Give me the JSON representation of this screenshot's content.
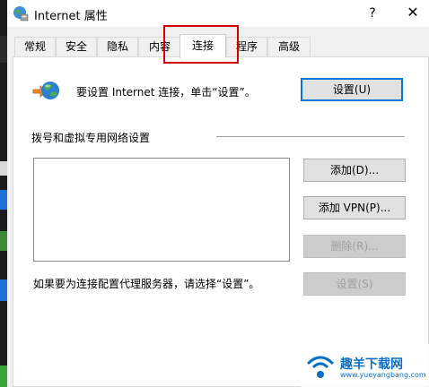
{
  "window": {
    "title": "Internet 属性",
    "help": "?",
    "close": "✕"
  },
  "tabs": [
    {
      "label": "常规"
    },
    {
      "label": "安全"
    },
    {
      "label": "隐私"
    },
    {
      "label": "内容"
    },
    {
      "label": "连接",
      "active": true
    },
    {
      "label": "程序"
    },
    {
      "label": "高级"
    }
  ],
  "connections": {
    "setup_text": "要设置 Internet 连接，单击“设置”。",
    "setup_button": "设置(U)",
    "dialup_section": "拨号和虚拟专用网络设置",
    "add_button": "添加(D)...",
    "add_vpn_button": "添加 VPN(P)...",
    "remove_button": "删除(R)...",
    "proxy_text": "如果要为连接配置代理服务器，请选择“设置”。",
    "settings_button": "设置(S)"
  },
  "watermark": {
    "main": "趣羊下载网",
    "sub": "www.yueyangbang.com"
  },
  "colors": {
    "highlight": "#d40000",
    "accent": "#0078d7",
    "watermark": "#0a6fc2"
  }
}
